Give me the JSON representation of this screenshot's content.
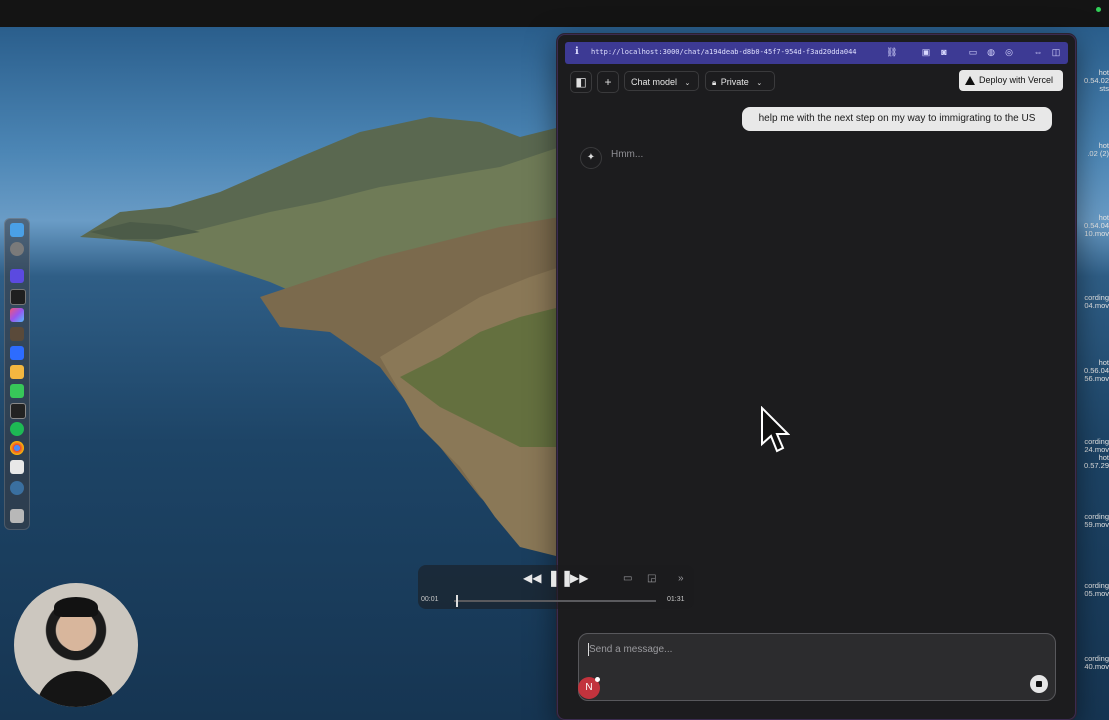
{
  "browser": {
    "url": "http://localhost:3000/chat/a194deab-d8b0-45f7-954d-f3ad20dda044"
  },
  "chat_toolbar": {
    "model_label": "Chat model",
    "visibility_label": "Private",
    "deploy_label": "Deploy with Vercel"
  },
  "messages": {
    "user": "help me with the next step on my way to immigrating to the US",
    "assistant": "Hmm..."
  },
  "composer": {
    "placeholder": "Send a message...",
    "badge": "N"
  },
  "media_player": {
    "current_time": "00:01",
    "duration": "01:31",
    "progress": 0.01
  },
  "desktop_files": [
    {
      "line1": "hot",
      "line2": "0.54.02",
      "line3": "sts"
    },
    {
      "line1": "hot",
      "line2": ".02 (2)",
      "line3": ""
    },
    {
      "line1": "hot",
      "line2": "0.54.04",
      "line3": "10.mov"
    },
    {
      "line1": "cording",
      "line2": "04.mov",
      "line3": ""
    },
    {
      "line1": "hot",
      "line2": "0.56.04",
      "line3": "56.mov"
    },
    {
      "line1": "cording",
      "line2": "24.mov",
      "line3": ""
    },
    {
      "line1": "hot",
      "line2": "0.57.29",
      "line3": ""
    },
    {
      "line1": "cording",
      "line2": "59.mov",
      "line3": ""
    },
    {
      "line1": "cording",
      "line2": "05.mov",
      "line3": ""
    },
    {
      "line1": "cording",
      "line2": "40.mov",
      "line3": ""
    }
  ],
  "colors": {
    "url_bar": "#3d3a94",
    "window_bg": "#1c1c1e",
    "badge": "#c2333d",
    "status_dot": "#31d158"
  },
  "icons": [
    "info-icon",
    "sidebar-toggle-icon",
    "plus-icon",
    "lock-icon",
    "chevron-down-icon",
    "vercel-triangle-icon",
    "sparkle-icon",
    "stop-icon",
    "rewind-icon",
    "pause-icon",
    "fast-forward-icon",
    "airplay-icon",
    "pip-icon",
    "mouse-pointer-icon"
  ]
}
